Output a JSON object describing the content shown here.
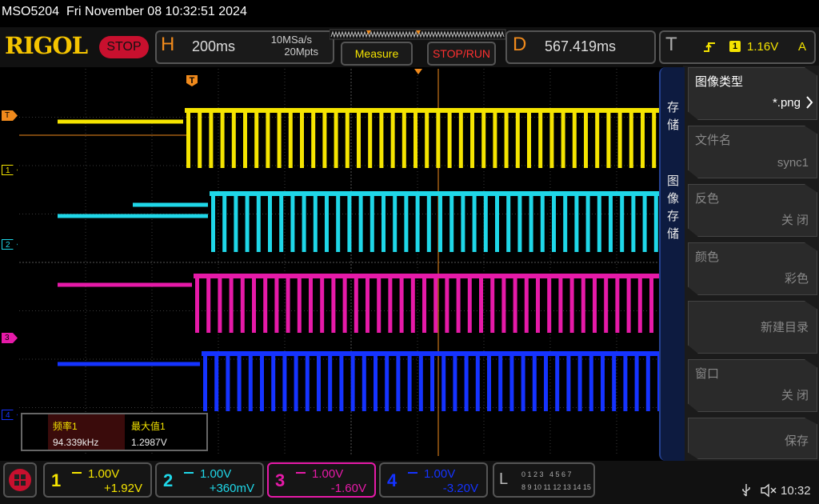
{
  "title": {
    "model": "MSO5204",
    "datetime": "Fri November 08 10:32:51 2024"
  },
  "header": {
    "brand": "RIGOL",
    "run_state": "STOP",
    "horizontal": {
      "letter": "H",
      "timebase": "200ms",
      "sample_rate": "10MSa/s",
      "memory_depth": "20Mpts"
    },
    "measure_label": "Measure",
    "stop_run_label": "STOP/RUN",
    "delay": {
      "letter": "D",
      "value": "567.419ms"
    },
    "trigger": {
      "letter": "T",
      "source": "1",
      "level": "1.16V",
      "mode": "A"
    }
  },
  "markers": {
    "trigger_marker": "T"
  },
  "channels": [
    {
      "num": "1",
      "scale": "1.00V",
      "offset": "+1.92V",
      "color": "#f5e400"
    },
    {
      "num": "2",
      "scale": "1.00V",
      "offset": "+360mV",
      "color": "#1fd7e8"
    },
    {
      "num": "3",
      "scale": "1.00V",
      "offset": "-1.60V",
      "color": "#e61aa8"
    },
    {
      "num": "4",
      "scale": "1.00V",
      "offset": "-3.20V",
      "color": "#1533ff"
    }
  ],
  "measurements": [
    {
      "label": "频率1",
      "value": "94.339kHz"
    },
    {
      "label": "最大值1",
      "value": "1.2987V"
    }
  ],
  "side_menu": {
    "tab1": "存储",
    "tab2": "图像存储",
    "items": [
      {
        "label": "图像类型",
        "value": "*.png"
      },
      {
        "label": "文件名",
        "value": "sync1"
      },
      {
        "label": "反色",
        "value": "关 闭"
      },
      {
        "label": "颜色",
        "value": "彩色"
      },
      {
        "label": "",
        "value": "新建目录"
      },
      {
        "label": "窗口",
        "value": "关 闭"
      },
      {
        "label": "",
        "value": "保存"
      }
    ]
  },
  "logic": {
    "letter": "L",
    "row1": "0 1 2 3   4 5 6 7",
    "row2": "8 9 10 11 12 13 14 15"
  },
  "status": {
    "time": "10:32"
  }
}
